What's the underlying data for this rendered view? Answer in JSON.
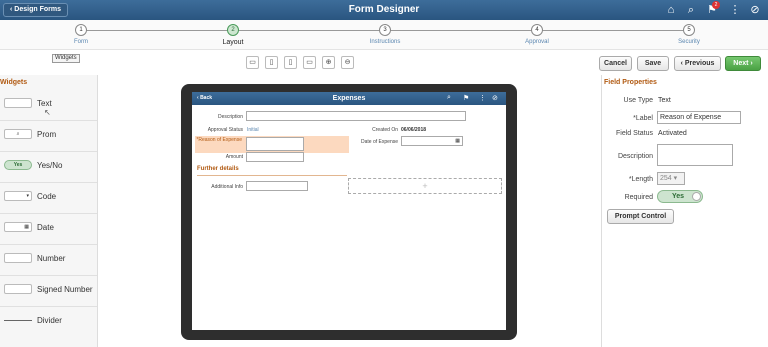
{
  "header": {
    "back_label": "Design Forms",
    "title": "Form Designer",
    "notification_count": "2"
  },
  "steps": [
    {
      "num": "1",
      "label": "Form"
    },
    {
      "num": "2",
      "label": "Layout"
    },
    {
      "num": "3",
      "label": "Instructions"
    },
    {
      "num": "4",
      "label": "Approval"
    },
    {
      "num": "5",
      "label": "Security"
    }
  ],
  "actions": {
    "cancel": "Cancel",
    "save": "Save",
    "previous": "Previous",
    "next": "Next"
  },
  "widgets": {
    "title": "Widgets",
    "tooltip": "Widgets",
    "yes_box": "Yes",
    "items": [
      {
        "label": "Text"
      },
      {
        "label": "Prom"
      },
      {
        "label": "Yes/No"
      },
      {
        "label": "Code"
      },
      {
        "label": "Date"
      },
      {
        "label": "Number"
      },
      {
        "label": "Signed Number"
      },
      {
        "label": "Divider"
      }
    ]
  },
  "form": {
    "back": "Back",
    "title": "Expenses",
    "description_label": "Description",
    "approval_status_label": "Approval Status",
    "approval_status_value": "Initial",
    "created_on_label": "Created On",
    "created_on_value": "06/06/2018",
    "reason_label": "*Reason of Expense",
    "date_label": "Date of Expense",
    "amount_label": "Amount",
    "further_details": "Further details",
    "additional_info_label": "Additional Info"
  },
  "properties": {
    "title": "Field Properties",
    "use_type_label": "Use Type",
    "use_type_value": "Text",
    "label_label": "*Label",
    "label_value": "Reason of Expense",
    "field_status_label": "Field Status",
    "field_status_value": "Activated",
    "description_label": "Description",
    "length_label": "*Length",
    "length_value": "254",
    "required_label": "Required",
    "required_value": "Yes",
    "prompt_button": "Prompt Control"
  },
  "colors": {
    "header": "#2f5d8a",
    "accent_orange": "#b15a12",
    "next_green": "#4aa244",
    "highlight": "#fcd9bf"
  }
}
